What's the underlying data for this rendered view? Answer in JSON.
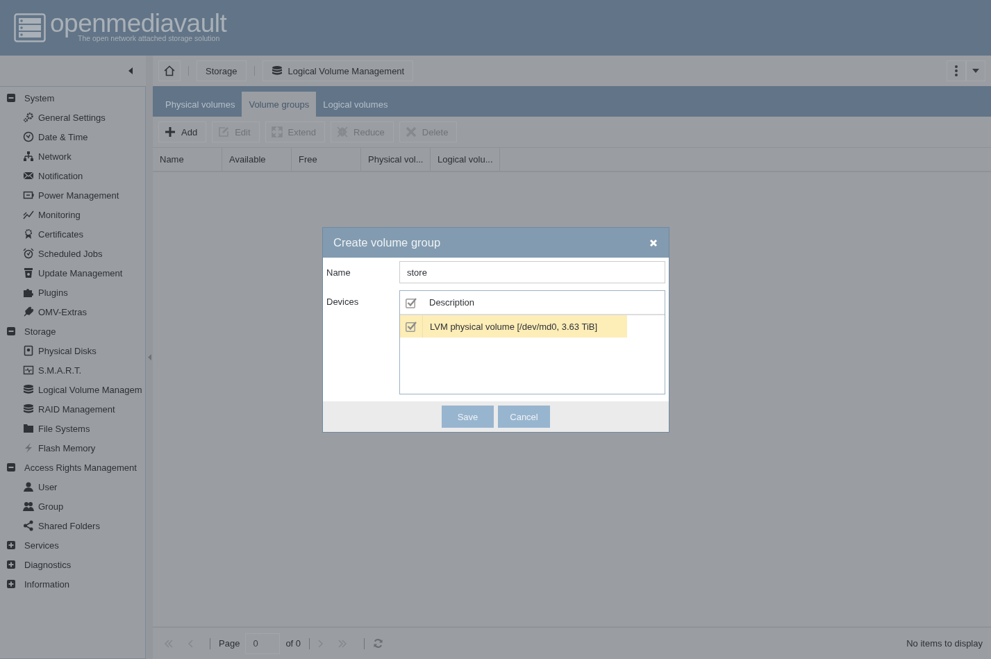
{
  "header": {
    "logo_text": "openmediavault",
    "tagline": "The open network attached storage solution"
  },
  "breadcrumb": [
    {
      "label": "Storage",
      "kind": "plain"
    },
    {
      "label": "Logical Volume Management",
      "kind": "database"
    }
  ],
  "sidebar": {
    "groups": [
      {
        "label": "System",
        "expanded": true,
        "children": [
          {
            "label": "General Settings"
          },
          {
            "label": "Date & Time"
          },
          {
            "label": "Network"
          },
          {
            "label": "Notification"
          },
          {
            "label": "Power Management"
          },
          {
            "label": "Monitoring"
          },
          {
            "label": "Certificates"
          },
          {
            "label": "Scheduled Jobs"
          },
          {
            "label": "Update Management"
          },
          {
            "label": "Plugins"
          },
          {
            "label": "OMV-Extras"
          }
        ]
      },
      {
        "label": "Storage",
        "expanded": true,
        "children": [
          {
            "label": "Physical Disks"
          },
          {
            "label": "S.M.A.R.T."
          },
          {
            "label": "Logical Volume Managem"
          },
          {
            "label": "RAID Management"
          },
          {
            "label": "File Systems"
          },
          {
            "label": "Flash Memory"
          }
        ]
      },
      {
        "label": "Access Rights Management",
        "expanded": true,
        "children": [
          {
            "label": "User"
          },
          {
            "label": "Group"
          },
          {
            "label": "Shared Folders"
          }
        ]
      },
      {
        "label": "Services",
        "expanded": false
      },
      {
        "label": "Diagnostics",
        "expanded": false
      },
      {
        "label": "Information",
        "expanded": false
      }
    ]
  },
  "tabs": [
    {
      "label": "Physical volumes",
      "selected": false
    },
    {
      "label": "Volume groups",
      "selected": true
    },
    {
      "label": "Logical volumes",
      "selected": false
    }
  ],
  "toolbar": [
    {
      "label": "Add",
      "disabled": false
    },
    {
      "label": "Edit",
      "disabled": true
    },
    {
      "label": "Extend",
      "disabled": true
    },
    {
      "label": "Reduce",
      "disabled": true
    },
    {
      "label": "Delete",
      "disabled": true
    }
  ],
  "table": {
    "columns": [
      "Name",
      "Available",
      "Free",
      "Physical vol...",
      "Logical volu..."
    ]
  },
  "pager": {
    "page_label": "Page",
    "page_value": "0",
    "of_label": "of 0",
    "status": "No items to display"
  },
  "dialog": {
    "title": "Create volume group",
    "name_label": "Name",
    "name_value": "store",
    "devices_label": "Devices",
    "devices_header": "Description",
    "header_checked": true,
    "devices": [
      {
        "label": "LVM physical volume [/dev/md0, 3.63 TiB]",
        "checked": true,
        "selected": true
      }
    ],
    "buttons": [
      {
        "label": "Save"
      },
      {
        "label": "Cancel"
      }
    ]
  }
}
